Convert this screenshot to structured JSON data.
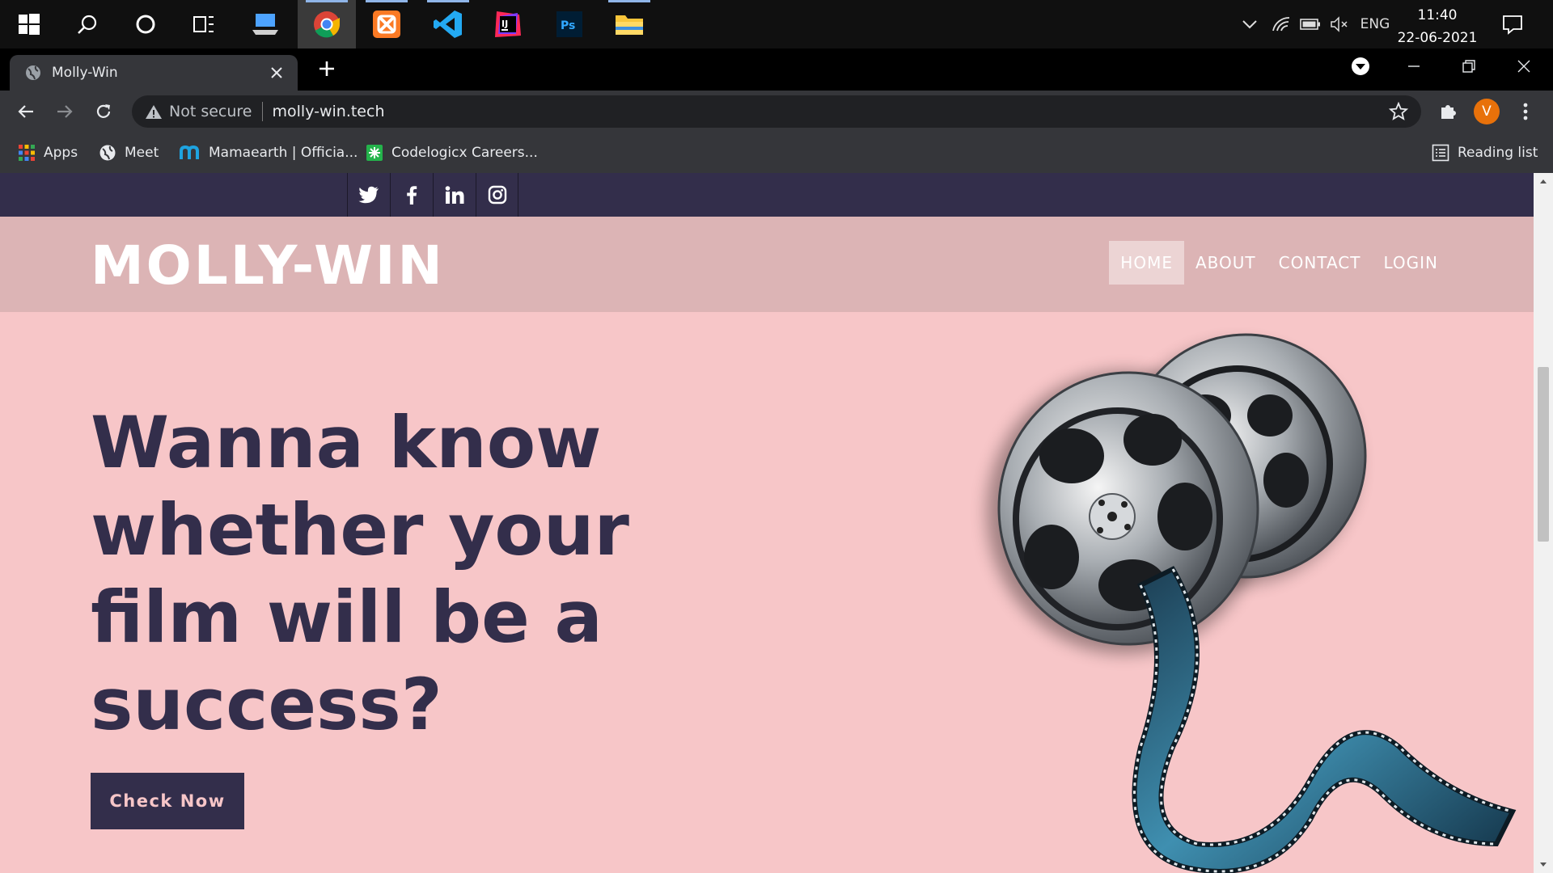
{
  "taskbar": {
    "apps": [
      {
        "icon": "search-icon"
      },
      {
        "icon": "cortana-icon"
      },
      {
        "icon": "task-view-icon"
      },
      {
        "icon": "laptop-app-icon"
      },
      {
        "icon": "chrome-icon"
      },
      {
        "icon": "xampp-icon"
      },
      {
        "icon": "vscode-icon"
      },
      {
        "icon": "intellij-icon",
        "text": "IJ"
      },
      {
        "icon": "photoshop-icon",
        "text": "Ps"
      },
      {
        "icon": "file-explorer-icon"
      }
    ],
    "tray": {
      "language": "ENG",
      "time": "11:40",
      "date": "22-06-2021"
    }
  },
  "browser": {
    "tab_title": "Molly-Win",
    "security_label": "Not secure",
    "url": "molly-win.tech",
    "profile_initial": "V",
    "bookmarks": [
      {
        "label": "Apps",
        "icon": "apps-grid-icon"
      },
      {
        "label": "Meet",
        "icon": "globe-icon"
      },
      {
        "label": "Mamaearth | Officia...",
        "icon": "mamaearth-icon"
      },
      {
        "label": "Codelogicx Careers...",
        "icon": "codelogicx-icon"
      }
    ],
    "reading_list": "Reading list"
  },
  "site": {
    "logo": "MOLLY-WIN",
    "social": [
      "twitter-icon",
      "facebook-icon",
      "linkedin-icon",
      "instagram-icon"
    ],
    "nav": [
      {
        "label": "HOME",
        "active": true
      },
      {
        "label": "ABOUT",
        "active": false
      },
      {
        "label": "CONTACT",
        "active": false
      },
      {
        "label": "LOGIN",
        "active": false
      }
    ],
    "hero_title": "Wanna know whether your film will be a success?",
    "cta_label": "Check Now",
    "hero_image": "film-reel-illustration",
    "colors": {
      "page_bg": "#f7c6c8",
      "header_bg": "#dcb4b5",
      "dark": "#332e4b"
    }
  }
}
